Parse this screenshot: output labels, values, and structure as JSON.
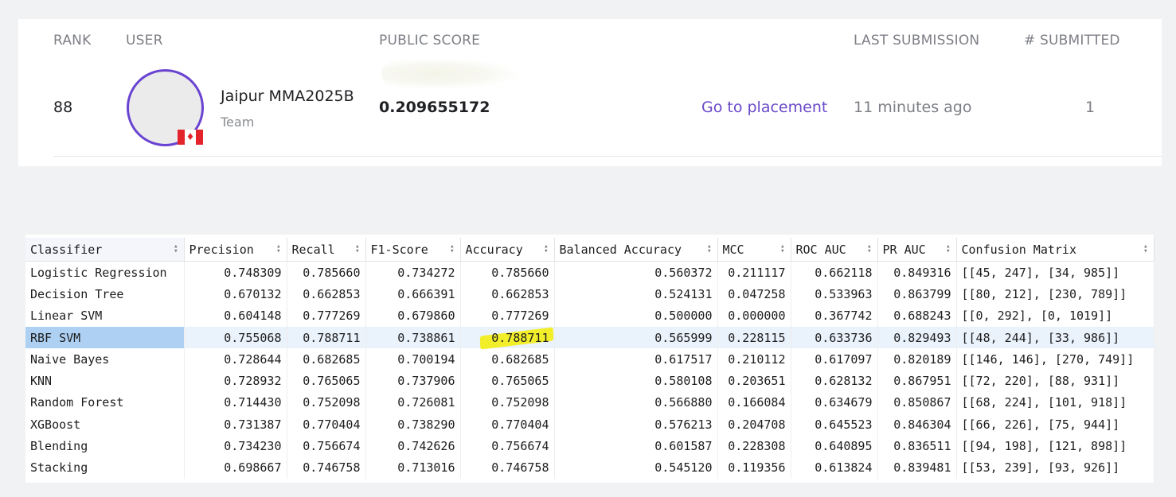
{
  "leaderboard": {
    "headers": {
      "rank": "RANK",
      "user": "USER",
      "public_score": "PUBLIC SCORE",
      "last_submission": "LAST SUBMISSION",
      "submitted": "# SUBMITTED"
    },
    "entry": {
      "rank": "88",
      "team_name": "Jaipur MMA2025B",
      "team_type": "Team",
      "score": "0.209655172",
      "goto_label": "Go to placement",
      "last_submission": "11 minutes ago",
      "submitted": "1",
      "avatar_ring_color": "#6a44d1",
      "flag_icon": "canada-flag-icon"
    }
  },
  "metrics_table": {
    "columns": [
      "Classifier",
      "Precision",
      "Recall",
      "F1-Score",
      "Accuracy",
      "Balanced Accuracy",
      "MCC",
      "ROC AUC",
      "PR AUC",
      "Confusion Matrix"
    ],
    "selected_row": "RBF SVM",
    "highlighted_cell": "0.788711",
    "rows": [
      {
        "classifier": "Logistic Regression",
        "precision": "0.748309",
        "recall": "0.785660",
        "f1": "0.734272",
        "accuracy": "0.785660",
        "balanced_accuracy": "0.560372",
        "mcc": "0.211117",
        "roc_auc": "0.662118",
        "pr_auc": "0.849316",
        "confusion_matrix": "[[45, 247], [34, 985]]"
      },
      {
        "classifier": "Decision Tree",
        "precision": "0.670132",
        "recall": "0.662853",
        "f1": "0.666391",
        "accuracy": "0.662853",
        "balanced_accuracy": "0.524131",
        "mcc": "0.047258",
        "roc_auc": "0.533963",
        "pr_auc": "0.863799",
        "confusion_matrix": "[[80, 212], [230, 789]]"
      },
      {
        "classifier": "Linear SVM",
        "precision": "0.604148",
        "recall": "0.777269",
        "f1": "0.679860",
        "accuracy": "0.777269",
        "balanced_accuracy": "0.500000",
        "mcc": "0.000000",
        "roc_auc": "0.367742",
        "pr_auc": "0.688243",
        "confusion_matrix": "[[0, 292], [0, 1019]]"
      },
      {
        "classifier": "RBF SVM",
        "precision": "0.755068",
        "recall": "0.788711",
        "f1": "0.738861",
        "accuracy": "0.788711",
        "balanced_accuracy": "0.565999",
        "mcc": "0.228115",
        "roc_auc": "0.633736",
        "pr_auc": "0.829493",
        "confusion_matrix": "[[48, 244], [33, 986]]"
      },
      {
        "classifier": "Naive Bayes",
        "precision": "0.728644",
        "recall": "0.682685",
        "f1": "0.700194",
        "accuracy": "0.682685",
        "balanced_accuracy": "0.617517",
        "mcc": "0.210112",
        "roc_auc": "0.617097",
        "pr_auc": "0.820189",
        "confusion_matrix": "[[146, 146], [270, 749]]"
      },
      {
        "classifier": "KNN",
        "precision": "0.728932",
        "recall": "0.765065",
        "f1": "0.737906",
        "accuracy": "0.765065",
        "balanced_accuracy": "0.580108",
        "mcc": "0.203651",
        "roc_auc": "0.628132",
        "pr_auc": "0.867951",
        "confusion_matrix": "[[72, 220], [88, 931]]"
      },
      {
        "classifier": "Random Forest",
        "precision": "0.714430",
        "recall": "0.752098",
        "f1": "0.726081",
        "accuracy": "0.752098",
        "balanced_accuracy": "0.566880",
        "mcc": "0.166084",
        "roc_auc": "0.634679",
        "pr_auc": "0.850867",
        "confusion_matrix": "[[68, 224], [101, 918]]"
      },
      {
        "classifier": "XGBoost",
        "precision": "0.731387",
        "recall": "0.770404",
        "f1": "0.738290",
        "accuracy": "0.770404",
        "balanced_accuracy": "0.576213",
        "mcc": "0.204708",
        "roc_auc": "0.645523",
        "pr_auc": "0.846304",
        "confusion_matrix": "[[66, 226], [75, 944]]"
      },
      {
        "classifier": "Blending",
        "precision": "0.734230",
        "recall": "0.756674",
        "f1": "0.742626",
        "accuracy": "0.756674",
        "balanced_accuracy": "0.601587",
        "mcc": "0.228308",
        "roc_auc": "0.640895",
        "pr_auc": "0.836511",
        "confusion_matrix": "[[94, 198], [121, 898]]"
      },
      {
        "classifier": "Stacking",
        "precision": "0.698667",
        "recall": "0.746758",
        "f1": "0.713016",
        "accuracy": "0.746758",
        "balanced_accuracy": "0.545120",
        "mcc": "0.119356",
        "roc_auc": "0.613824",
        "pr_auc": "0.839481",
        "confusion_matrix": "[[53, 239], [93, 926]]"
      }
    ]
  }
}
